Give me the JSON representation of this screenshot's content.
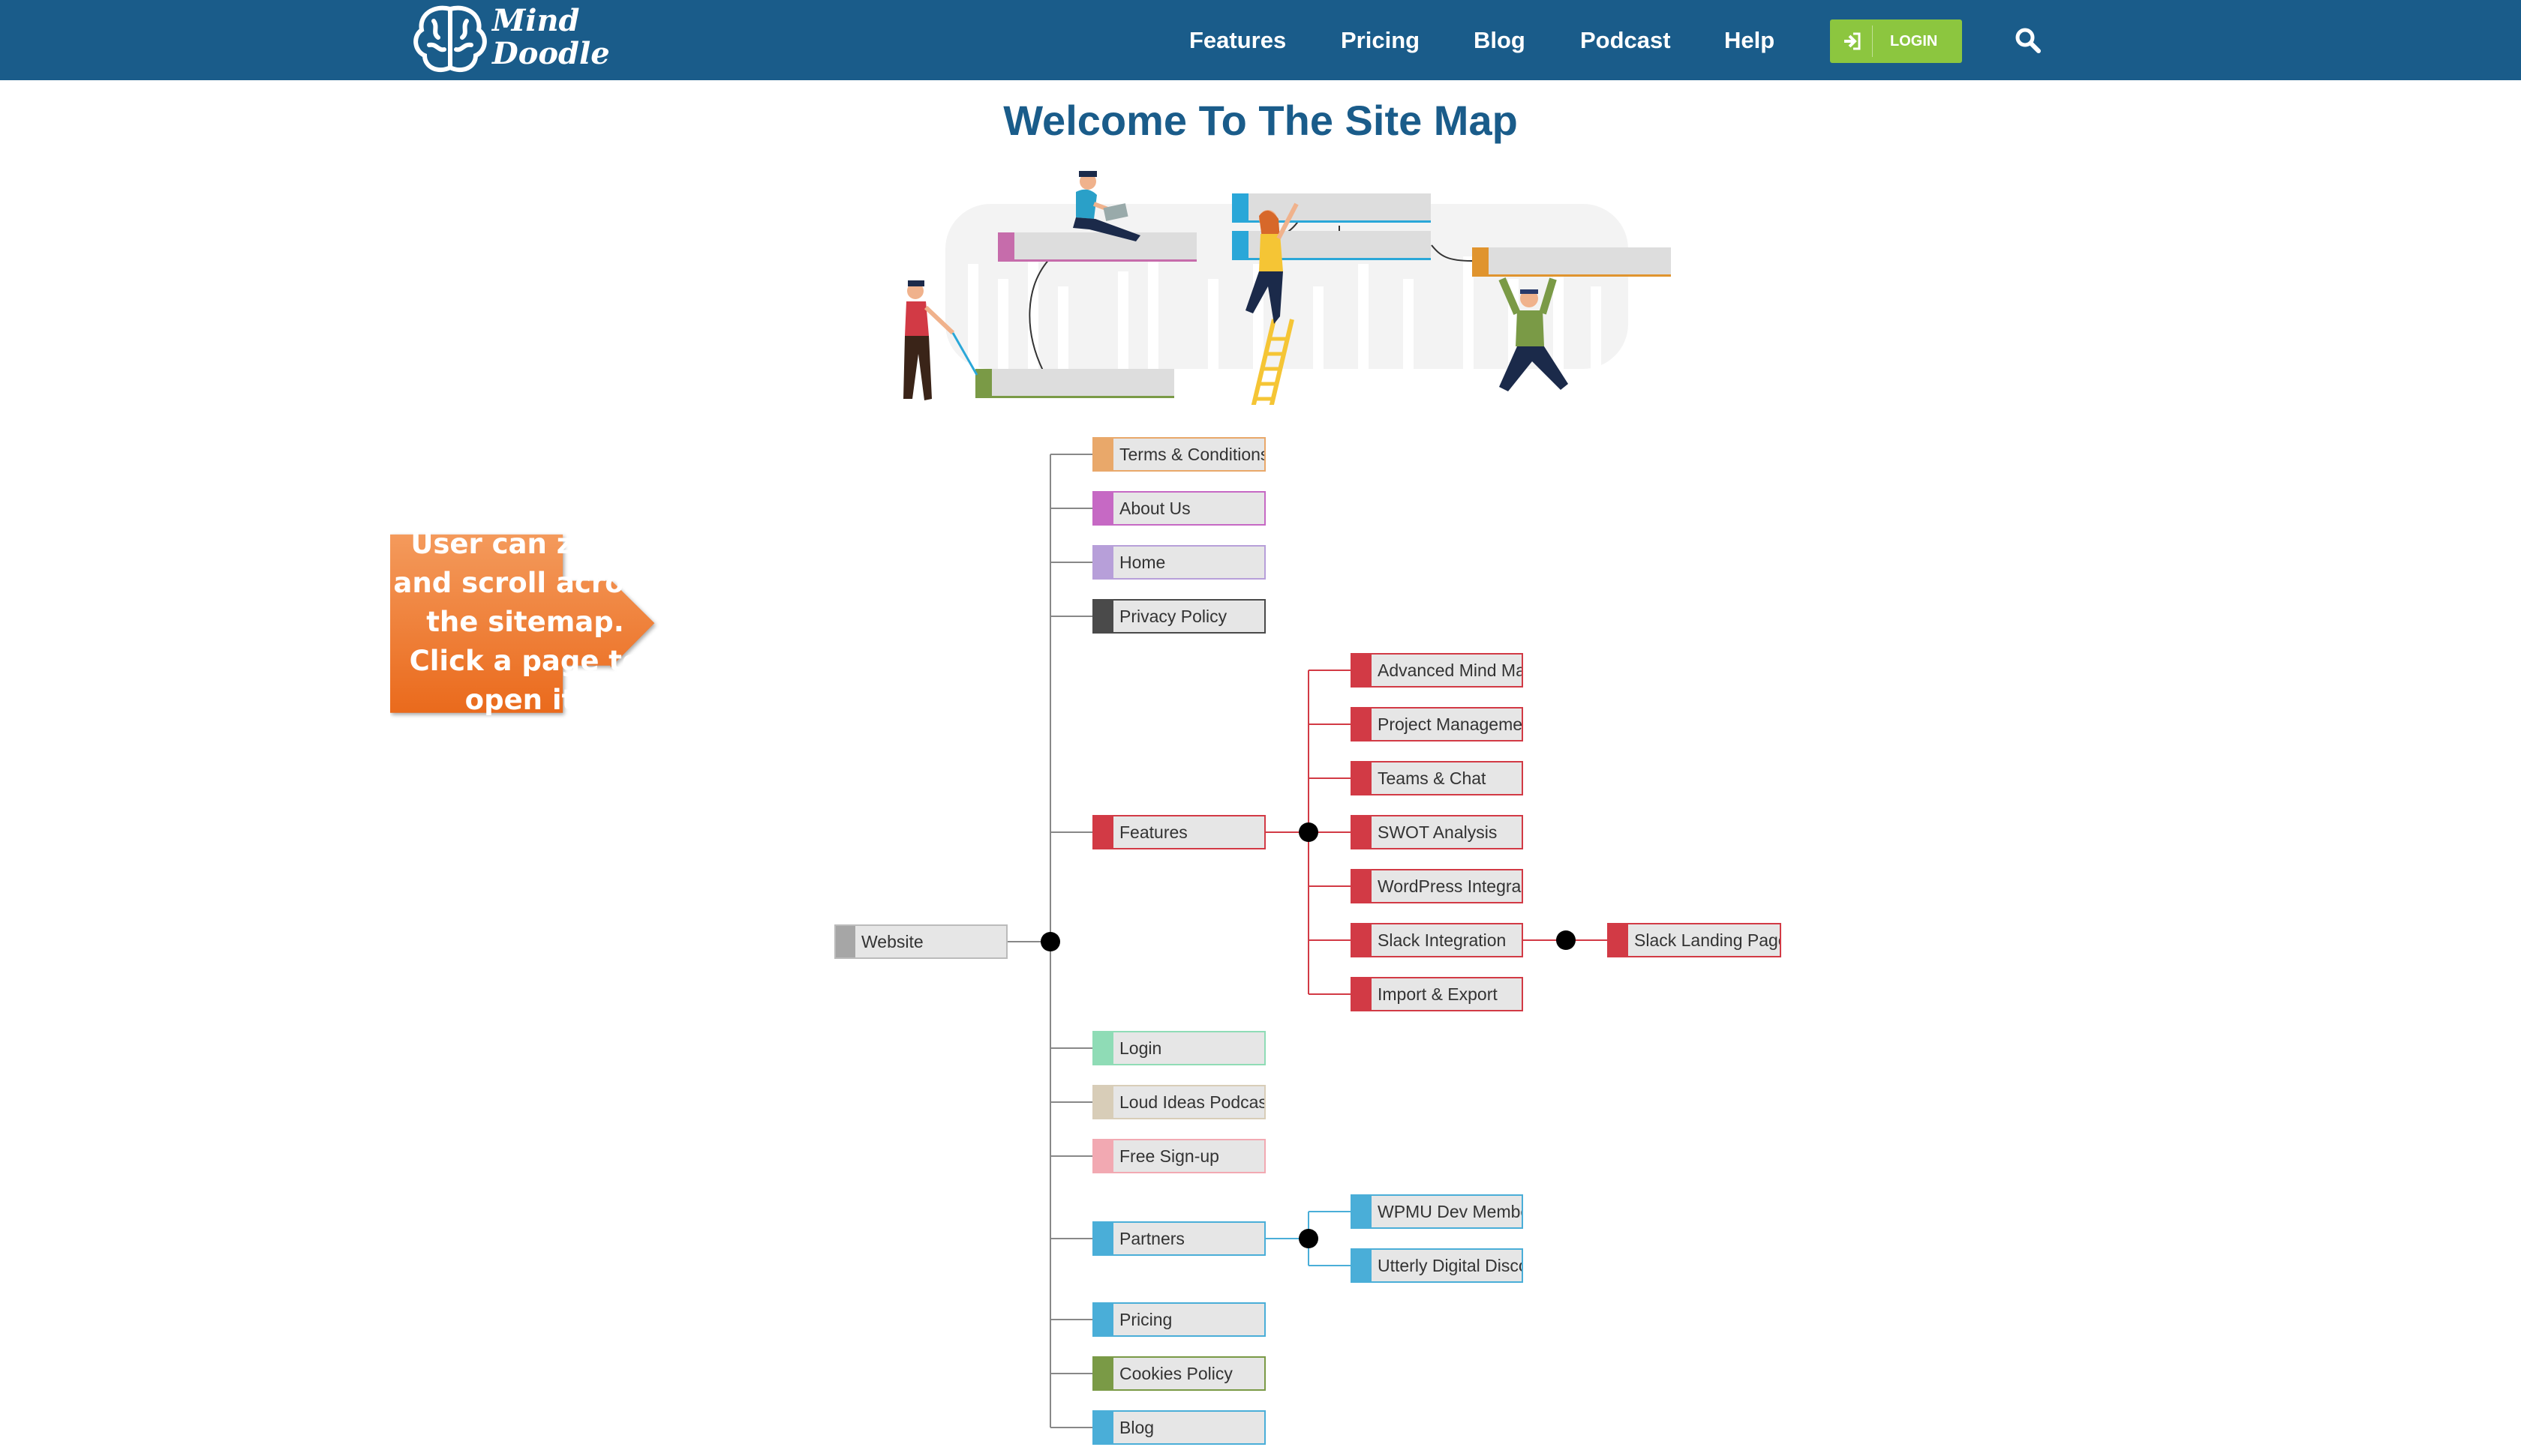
{
  "header": {
    "logo": {
      "line1": "Mind",
      "line2": "Doodle"
    },
    "nav": [
      "Features",
      "Pricing",
      "Blog",
      "Podcast",
      "Help"
    ],
    "login_label": "LOGIN",
    "icons": {
      "login": "sign-in-icon",
      "search": "search-icon"
    },
    "colors": {
      "bar": "#1a5c8a",
      "login": "#8cc63f"
    }
  },
  "page_title": "Welcome To The Site Map",
  "callout": {
    "lines": [
      "User can zoom",
      "and scroll across",
      "the sitemap.",
      "Click a page to",
      "open it."
    ],
    "color": "#f07a2a"
  },
  "sitemap": {
    "root": {
      "label": "Website",
      "color": "#a6a6a6"
    },
    "pages": [
      {
        "label": "Terms & Conditions",
        "color": "#e9a86a"
      },
      {
        "label": "About Us",
        "color": "#c669c4"
      },
      {
        "label": "Home",
        "color": "#b79fd9"
      },
      {
        "label": "Privacy Policy",
        "color": "#4a4a4a"
      },
      {
        "label": "Features",
        "color": "#d23a45"
      },
      {
        "label": "Login",
        "color": "#8fdcb6"
      },
      {
        "label": "Loud Ideas Podcast",
        "color": "#d8cdb8"
      },
      {
        "label": "Free Sign-up",
        "color": "#f2a9b2"
      },
      {
        "label": "Partners",
        "color": "#4aaed8"
      },
      {
        "label": "Pricing",
        "color": "#4aaed8"
      },
      {
        "label": "Cookies Policy",
        "color": "#7a9a46"
      },
      {
        "label": "Blog",
        "color": "#4aaed8"
      }
    ],
    "features_children": [
      "Advanced Mind Ma",
      "Project Manageme",
      "Teams & Chat",
      "SWOT Analysis",
      "WordPress Integra",
      "Slack Integration",
      "Import & Export"
    ],
    "slack_children": [
      "Slack Landing Page"
    ],
    "partners_children": [
      "WPMU Dev Membe",
      "Utterly Digital Disco"
    ]
  }
}
